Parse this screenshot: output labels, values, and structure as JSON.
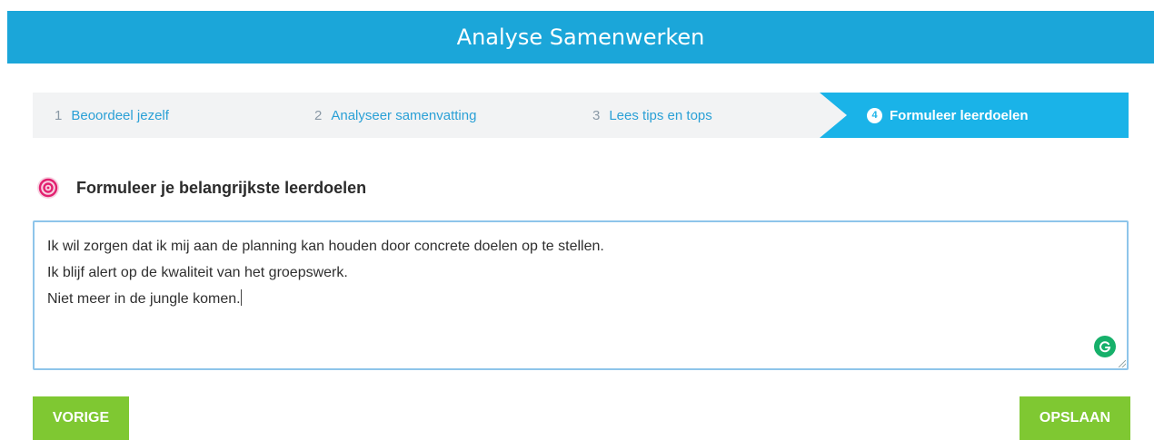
{
  "header": {
    "title": "Analyse Samenwerken"
  },
  "steps": [
    {
      "number": "1",
      "label": "Beoordeel jezelf"
    },
    {
      "number": "2",
      "label": "Analyseer samenvatting"
    },
    {
      "number": "3",
      "label": "Lees tips en tops"
    },
    {
      "number": "4",
      "label": "Formuleer leerdoelen"
    }
  ],
  "section": {
    "title": "Formuleer je belangrijkste leerdoelen",
    "icon": "target-icon"
  },
  "editor": {
    "lines": [
      "Ik wil zorgen dat ik mij aan de planning kan houden door concrete doelen op te stellen.",
      "Ik blijf alert op de kwaliteit van het groepswerk.",
      "Niet meer in de jungle komen."
    ],
    "assistant_icon": "grammarly-icon"
  },
  "buttons": {
    "previous": "VORIGE",
    "save": "OPSLAAN"
  },
  "colors": {
    "header": "#1ba6d9",
    "active_step": "#1ab3e8",
    "step_link": "#2aa0d6",
    "button": "#7fc832",
    "target_icon": "#e2206f"
  }
}
